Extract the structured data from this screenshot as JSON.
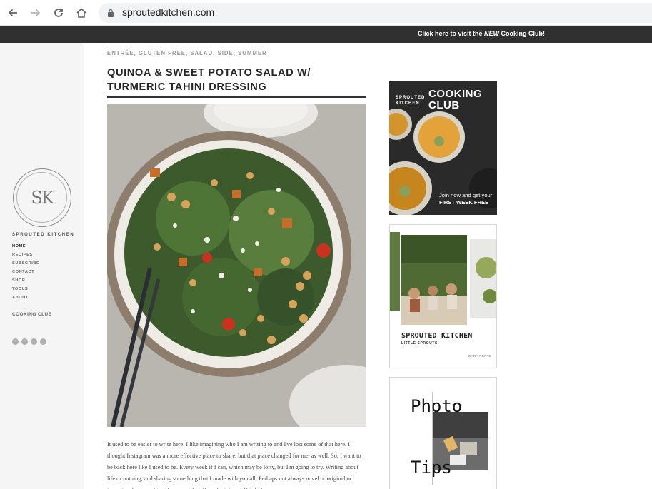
{
  "browser": {
    "url": "sproutedkitchen.com",
    "icons": [
      "back-icon",
      "forward-icon",
      "reload-icon",
      "home-icon",
      "lock-icon"
    ]
  },
  "promo": {
    "pre": "Click here to visit the ",
    "bold": "NEW",
    "post": " Cooking Club!"
  },
  "sidebar": {
    "logo_monogram": "SK",
    "brand": "SPROUTED KITCHEN",
    "menu": [
      "HOME",
      "RECIPES",
      "SUBSCRIBE",
      "CONTACT",
      "SHOP",
      "TOOLS",
      "ABOUT"
    ],
    "cooking_club": "COOKING CLUB",
    "socials": [
      "twitter-icon",
      "instagram-icon",
      "facebook-icon",
      "pinterest-icon"
    ]
  },
  "post": {
    "categories": "ENTRÉE, GLUTEN FREE, SALAD, SIDE, SUMMER",
    "title": "QUINOA & SWEET POTATO SALAD W/ TURMERIC TAHINI DRESSING",
    "body": "It used to be easier to write here. I like imagining who I am writing to and I've lost some of that here. I thought Instagram was a more effective place to share, but that place changed for me, as well. So, I want to be back here like I used to be. Every week if I can, which may be lofty, but I'm going to try. Writing about life or nothing, and sharing something that I made with you all. Perhaps not always novel or original or inventive, but something for your table. If you're joining. Would be"
  },
  "ads": {
    "club": {
      "small": "SPROUTED KITCHEN",
      "title": "COOKING CLUB",
      "cta_1": "Join now and get your",
      "cta_2": "FIRST WEEK FREE"
    },
    "book": {
      "title": "SPROUTED KITCHEN",
      "subtitle": "LITTLE SPROUTS",
      "author": "SARA FORTE"
    },
    "photo": {
      "word_1": "Photo",
      "word_2": "Tips"
    }
  },
  "colors": {
    "promo_bg": "#303030",
    "sidebar_bg": "#f5f5f5",
    "omnibox_bg": "#f1f3f4"
  }
}
